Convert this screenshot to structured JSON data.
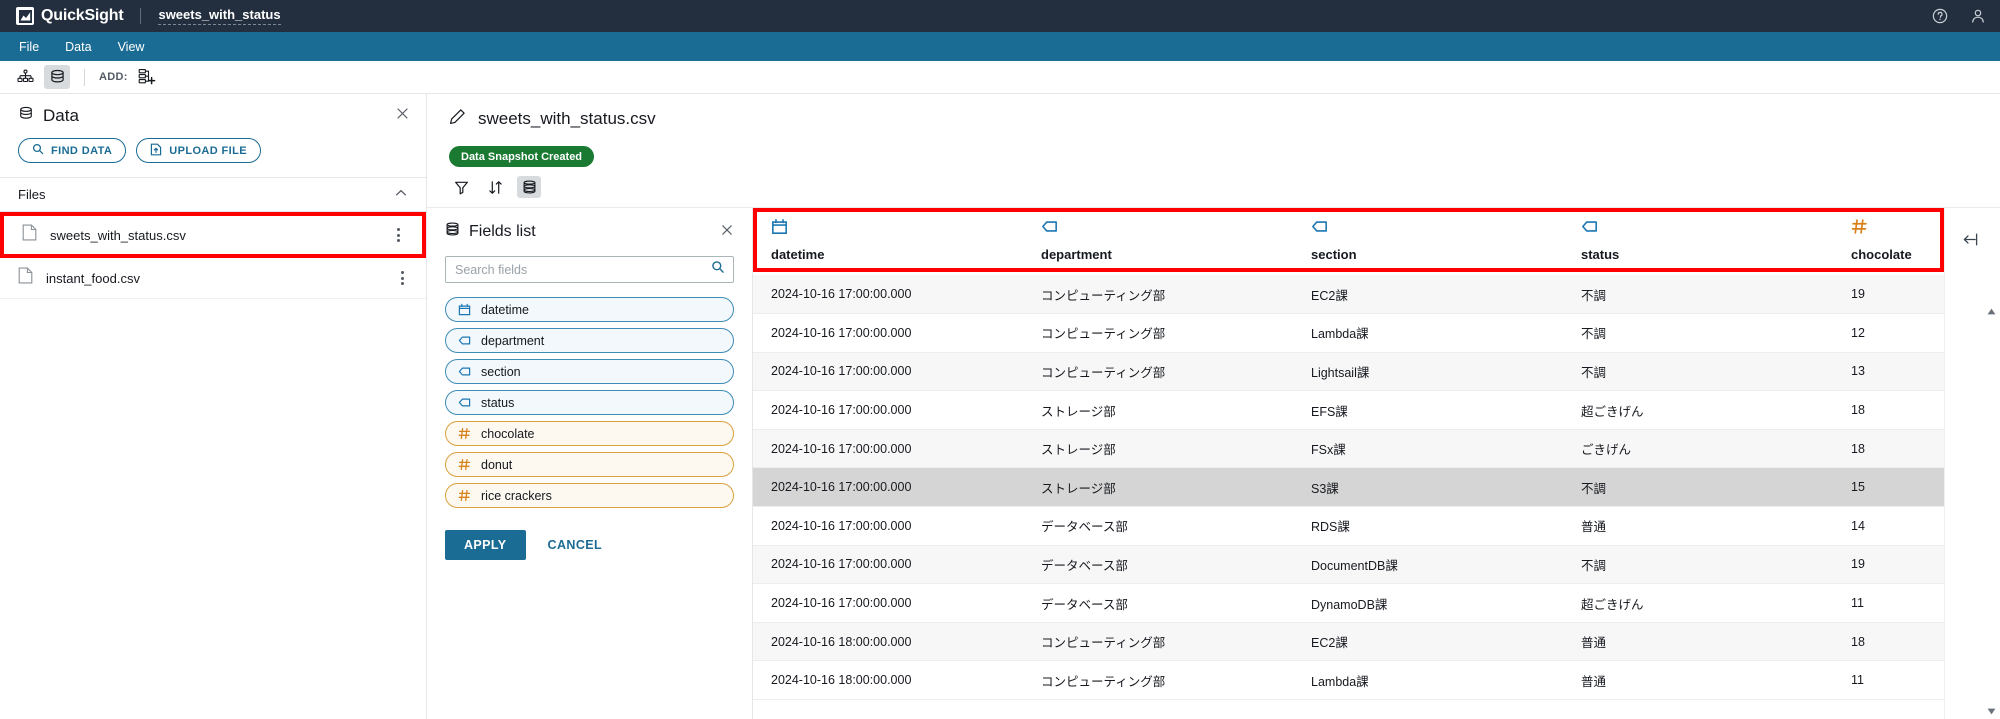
{
  "topbar": {
    "brand": "QuickSight",
    "logo_icon": "quicksight-logo-icon",
    "document_name": "sweets_with_status",
    "help_icon": "help-circle-icon",
    "account_icon": "user-account-icon"
  },
  "menubar": {
    "items": [
      {
        "label": "File"
      },
      {
        "label": "Data"
      },
      {
        "label": "View"
      }
    ]
  },
  "toolbar": {
    "join_icon": "join-diagram-icon",
    "dataset_icon": "database-icon",
    "add_label": "ADD:",
    "add_icon": "add-dataset-icon"
  },
  "data_panel": {
    "title": "Data",
    "title_icon": "database-icon",
    "close_icon": "close-icon",
    "find_data_label": "FIND DATA",
    "find_data_icon": "search-icon",
    "upload_file_label": "UPLOAD FILE",
    "upload_file_icon": "upload-icon",
    "files_section_label": "Files",
    "files_collapse_icon": "chevron-up-icon",
    "highlight_color": "#ff0000",
    "files": [
      {
        "name": "sweets_with_status.csv",
        "icon": "file-icon",
        "highlighted": true,
        "menu_icon": "kebab-menu-icon"
      },
      {
        "name": "instant_food.csv",
        "icon": "file-icon",
        "highlighted": false,
        "menu_icon": "kebab-menu-icon"
      }
    ]
  },
  "prep_panel": {
    "edit_icon": "pencil-edit-icon",
    "dataset_name": "sweets_with_status.csv",
    "status_badge": "Data Snapshot Created",
    "status_badge_color": "#1a7a32",
    "tools": [
      {
        "name": "filter-icon",
        "active": false
      },
      {
        "name": "sort-icon",
        "active": false
      },
      {
        "name": "fields-list-icon",
        "active": true
      }
    ]
  },
  "fields_list": {
    "title": "Fields list",
    "title_icon": "fields-list-icon",
    "close_icon": "close-icon",
    "search_placeholder": "Search fields",
    "search_value": "",
    "search_icon": "search-icon",
    "fields": [
      {
        "label": "datetime",
        "type": "date",
        "icon": "calendar-icon"
      },
      {
        "label": "department",
        "type": "dimension",
        "icon": "tag-icon"
      },
      {
        "label": "section",
        "type": "dimension",
        "icon": "tag-icon"
      },
      {
        "label": "status",
        "type": "dimension",
        "icon": "tag-icon"
      },
      {
        "label": "chocolate",
        "type": "measure",
        "icon": "hash-icon"
      },
      {
        "label": "donut",
        "type": "measure",
        "icon": "hash-icon"
      },
      {
        "label": "rice crackers",
        "type": "measure",
        "icon": "hash-icon"
      }
    ],
    "apply_label": "APPLY",
    "cancel_label": "CANCEL"
  },
  "table": {
    "highlight_color": "#ff0000",
    "columns": [
      {
        "label": "datetime",
        "type": "date",
        "icon": "calendar-icon"
      },
      {
        "label": "department",
        "type": "dimension",
        "icon": "tag-icon"
      },
      {
        "label": "section",
        "type": "dimension",
        "icon": "tag-icon"
      },
      {
        "label": "status",
        "type": "dimension",
        "icon": "tag-icon"
      },
      {
        "label": "chocolate",
        "type": "measure",
        "icon": "hash-icon"
      }
    ],
    "rows": [
      {
        "cells": [
          "2024-10-16 17:00:00.000",
          "コンピューティング部",
          "EC2課",
          "不調",
          "19"
        ],
        "state": "alt"
      },
      {
        "cells": [
          "2024-10-16 17:00:00.000",
          "コンピューティング部",
          "Lambda課",
          "不調",
          "12"
        ],
        "state": "normal"
      },
      {
        "cells": [
          "2024-10-16 17:00:00.000",
          "コンピューティング部",
          "Lightsail課",
          "不調",
          "13"
        ],
        "state": "alt"
      },
      {
        "cells": [
          "2024-10-16 17:00:00.000",
          "ストレージ部",
          "EFS課",
          "超ごきげん",
          "18"
        ],
        "state": "normal"
      },
      {
        "cells": [
          "2024-10-16 17:00:00.000",
          "ストレージ部",
          "FSx課",
          "ごきげん",
          "18"
        ],
        "state": "alt"
      },
      {
        "cells": [
          "2024-10-16 17:00:00.000",
          "ストレージ部",
          "S3課",
          "不調",
          "15"
        ],
        "state": "sel"
      },
      {
        "cells": [
          "2024-10-16 17:00:00.000",
          "データベース部",
          "RDS課",
          "普通",
          "14"
        ],
        "state": "normal"
      },
      {
        "cells": [
          "2024-10-16 17:00:00.000",
          "データベース部",
          "DocumentDB課",
          "不調",
          "19"
        ],
        "state": "alt"
      },
      {
        "cells": [
          "2024-10-16 17:00:00.000",
          "データベース部",
          "DynamoDB課",
          "超ごきげん",
          "11"
        ],
        "state": "normal"
      },
      {
        "cells": [
          "2024-10-16 18:00:00.000",
          "コンピューティング部",
          "EC2課",
          "普通",
          "18"
        ],
        "state": "alt"
      },
      {
        "cells": [
          "2024-10-16 18:00:00.000",
          "コンピューティング部",
          "Lambda課",
          "普通",
          "11"
        ],
        "state": "normal"
      }
    ]
  },
  "right_rail": {
    "collapse_icon": "collapse-panel-left-icon",
    "scroll_up_icon": "scroll-up-arrow-icon",
    "scroll_down_icon": "scroll-down-arrow-icon"
  }
}
